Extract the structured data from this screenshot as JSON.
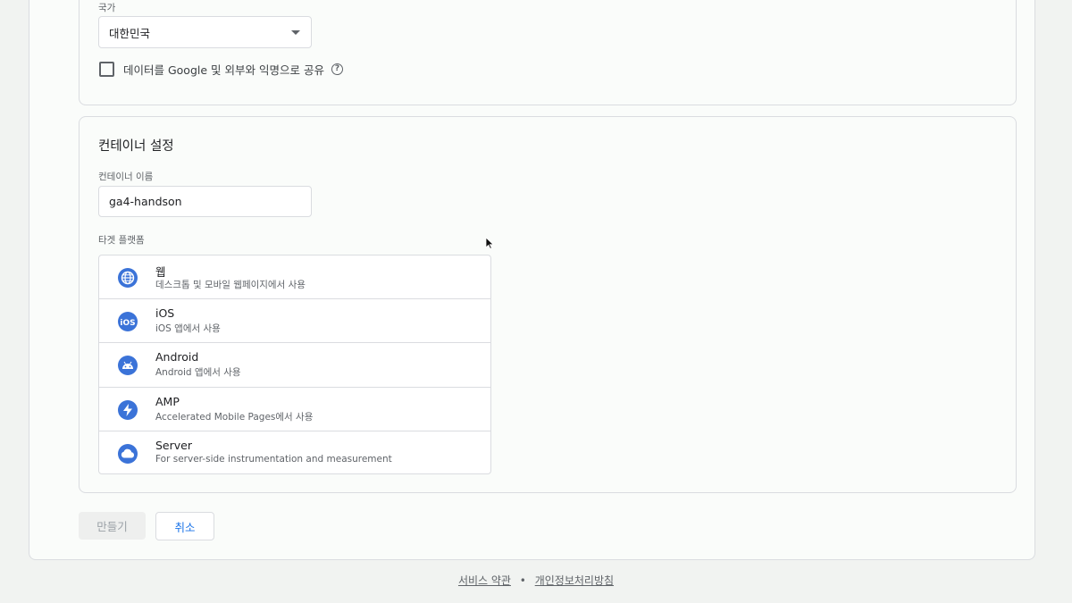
{
  "account": {
    "country_label": "국가",
    "country_value": "대한민국",
    "share_label": "데이터를 Google 및 외부와 익명으로 공유"
  },
  "container": {
    "section_title": "컨테이너 설정",
    "name_label": "컨테이너 이름",
    "name_value": "ga4-handson",
    "platform_label": "타겟 플랫폼",
    "platforms": [
      {
        "name": "웹",
        "desc": "데스크톱 및 모바일 웹페이지에서 사용",
        "icon": "globe-icon"
      },
      {
        "name": "iOS",
        "desc": "iOS 앱에서 사용",
        "icon": "ios-icon"
      },
      {
        "name": "Android",
        "desc": "Android 앱에서 사용",
        "icon": "android-icon"
      },
      {
        "name": "AMP",
        "desc": "Accelerated Mobile Pages에서 사용",
        "icon": "lightning-icon"
      },
      {
        "name": "Server",
        "desc": "For server-side instrumentation and measurement",
        "icon": "cloud-icon"
      }
    ]
  },
  "actions": {
    "create_label": "만들기",
    "cancel_label": "취소"
  },
  "footer": {
    "terms": "서비스 약관",
    "privacy": "개인정보처리방침",
    "separator": "•"
  },
  "colors": {
    "accent": "#1a73e8",
    "icon_bg": "#3b73d8"
  }
}
